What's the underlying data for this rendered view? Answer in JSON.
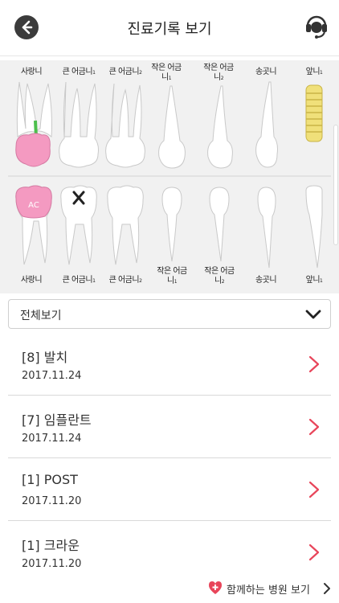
{
  "header": {
    "title": "진료기록 보기",
    "back_icon": "back-arrow-icon",
    "support_icon": "headset-icon"
  },
  "tooth_chart": {
    "upper_labels": [
      {
        "name": "사랑니",
        "sub": ""
      },
      {
        "name": "큰 어금니",
        "sub": "1"
      },
      {
        "name": "큰 어금니",
        "sub": "2"
      },
      {
        "name": "작은 어금니",
        "sub": "1"
      },
      {
        "name": "작은 어금니",
        "sub": "2"
      },
      {
        "name": "송곳니",
        "sub": ""
      },
      {
        "name": "앞니",
        "sub": "1"
      }
    ],
    "lower_labels": [
      {
        "name": "사랑니",
        "sub": ""
      },
      {
        "name": "큰 어금니",
        "sub": "1"
      },
      {
        "name": "큰 어금니",
        "sub": "2"
      },
      {
        "name": "작은 어금니",
        "sub": "1"
      },
      {
        "name": "작은 어금니",
        "sub": "2"
      },
      {
        "name": "송곳니",
        "sub": ""
      },
      {
        "name": "앞니",
        "sub": "1"
      }
    ],
    "crown_marker": "AC",
    "colors": {
      "treated": "#f49ac1",
      "root_canal": "#4cbf4c",
      "implant": "#f0e07a"
    }
  },
  "filter": {
    "selected": "전체보기",
    "icon": "chevron-down-icon"
  },
  "records": [
    {
      "title": "[8] 발치",
      "date": "2017.11.24"
    },
    {
      "title": "[7] 임플란트",
      "date": "2017.11.24"
    },
    {
      "title": "[1] POST",
      "date": "2017.11.20"
    },
    {
      "title": "[1] 크라운",
      "date": "2017.11.20"
    }
  ],
  "footer": {
    "hospital_link": "함께하는 병원 보기",
    "accent": "#e8455a"
  }
}
